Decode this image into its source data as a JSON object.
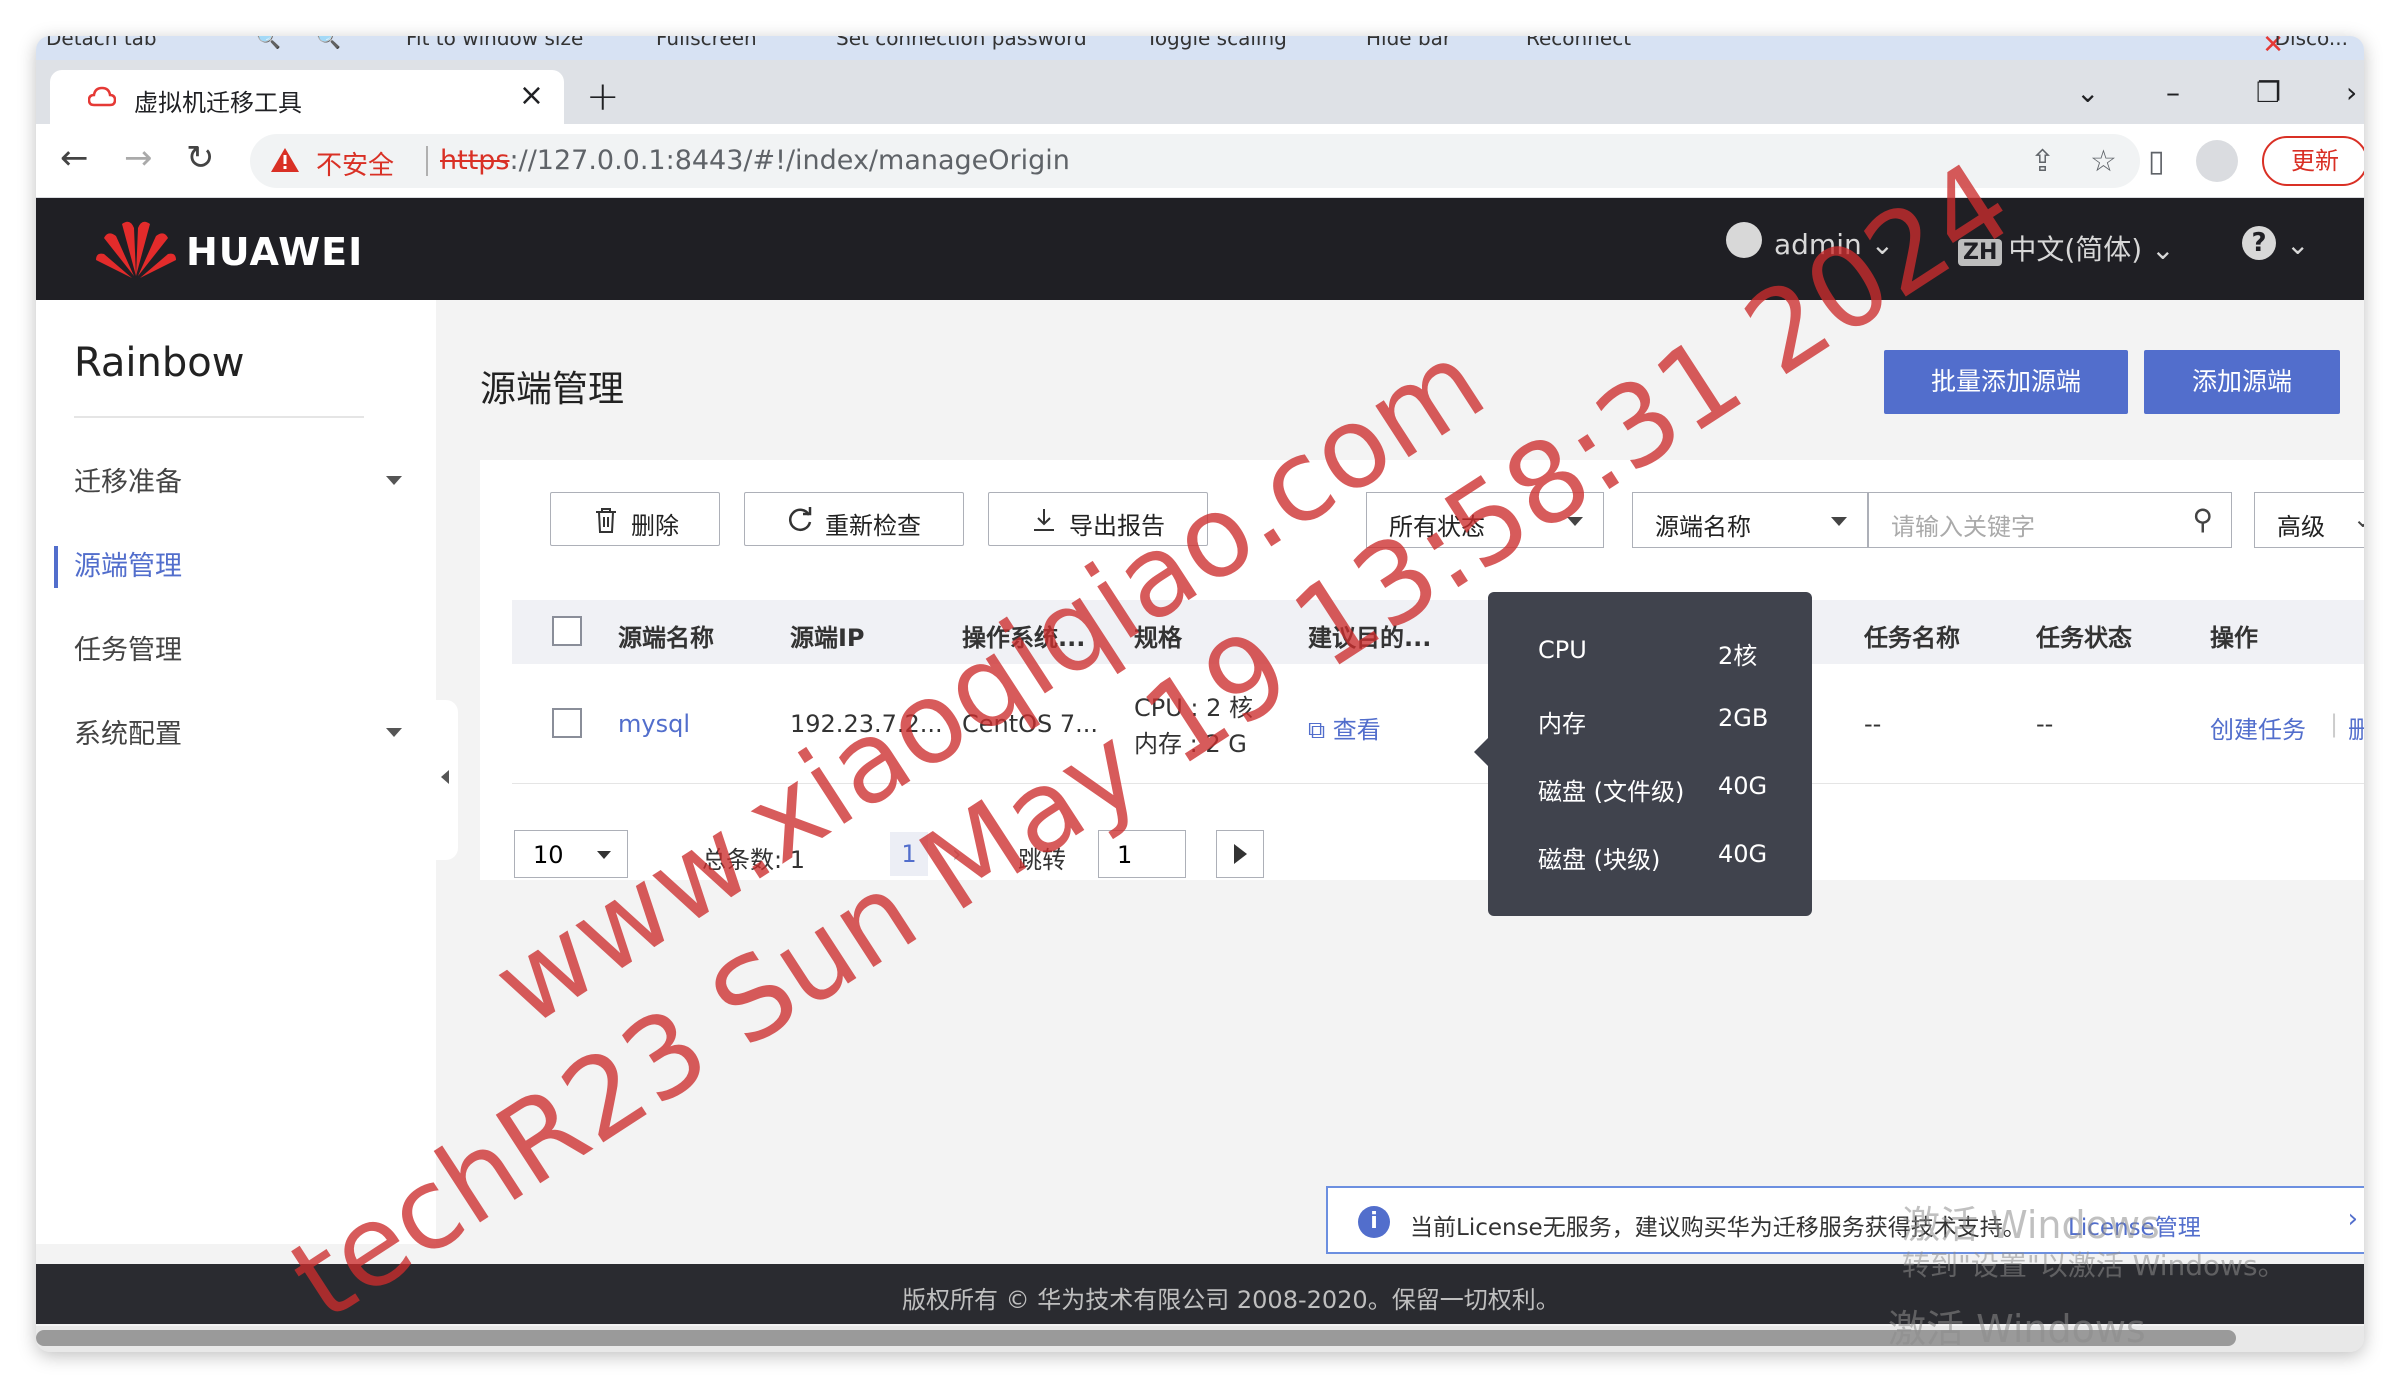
{
  "remote_toolbar": {
    "items": [
      "Detach tab",
      "Fit to window size",
      "Fullscreen",
      "Set connection password",
      "Toggle scaling",
      "Hide bar",
      "Reconnect"
    ],
    "disconnect": "Disco..."
  },
  "browser": {
    "tab_title": "虚拟机迁移工具",
    "new_tab": "+",
    "insecure_label": "不安全",
    "url_scheme": "https",
    "url_rest": "://127.0.0.1:8443/#!/index/manageOrigin",
    "update_label": "更新"
  },
  "header": {
    "brand": "HUAWEI",
    "user": "admin",
    "lang_badge": "ZH",
    "language": "中文(简体)",
    "help": "?"
  },
  "sidebar": {
    "title": "Rainbow",
    "items": [
      {
        "label": "迁移准备",
        "expandable": true
      },
      {
        "label": "源端管理",
        "active": true
      },
      {
        "label": "任务管理"
      },
      {
        "label": "系统配置",
        "expandable": true
      }
    ]
  },
  "main": {
    "title": "源端管理",
    "batch_add": "批量添加源端",
    "add": "添加源端",
    "toolbar": {
      "delete": "删除",
      "recheck": "重新检查",
      "export": "导出报告",
      "status_filter": "所有状态",
      "field_select": "源端名称",
      "search_placeholder": "请输入关键字",
      "advanced": "高级"
    },
    "columns": [
      "源端名称",
      "源端IP",
      "操作系统...",
      "规格",
      "建议目的...",
      "任务名称",
      "任务状态",
      "操作"
    ],
    "rows": [
      {
        "name": "mysql",
        "ip": "192.23.7.2...",
        "os": "CentOS 7...",
        "spec_cpu": "CPU : 2 核",
        "spec_mem": "内存 : 2 G",
        "suggest": "查看",
        "task_name": "--",
        "task_status": "--",
        "op_create": "创建任务",
        "op_delete": "删除"
      }
    ],
    "pager": {
      "page_size": "10",
      "total": "总条数: 1",
      "current": "1",
      "next": "›",
      "jump_label": "跳转",
      "jump_value": "1"
    }
  },
  "tooltip": [
    {
      "k": "CPU",
      "v": "2核"
    },
    {
      "k": "内存",
      "v": "2GB"
    },
    {
      "k": "磁盘 (文件级)",
      "v": "40G"
    },
    {
      "k": "磁盘 (块级)",
      "v": "40G"
    }
  ],
  "license": {
    "text": "当前License无服务，建议购买华为迁移服务获得技术支持。",
    "link": "License管理"
  },
  "footer": "版权所有 © 华为技术有限公司 2008-2020。保留一切权利。",
  "windows_activation": {
    "line1": "激活 Windows",
    "line2": "转到\"设置\"以激活 Windows。",
    "line3": "激活 Windows"
  },
  "watermark": {
    "line1": "www.xiaoqiqiao.com",
    "line2": "techR23 Sun May 19 13:58:31 2024"
  },
  "colors": {
    "accent": "#526ecc",
    "header_bg": "#1f1f24",
    "danger": "#d93025",
    "watermark": "#cc2d2d"
  }
}
